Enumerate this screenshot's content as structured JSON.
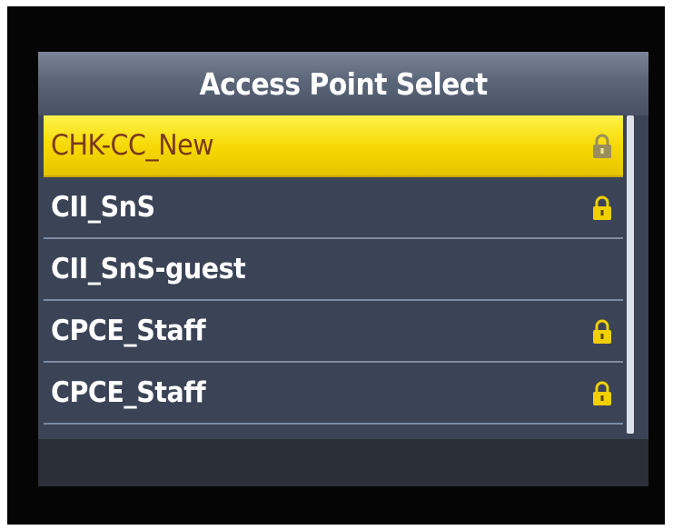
{
  "title": "Access Point Select",
  "access_points": [
    {
      "ssid": "CHK-CC_New",
      "secured": true,
      "selected": true,
      "icon": "lock-icon"
    },
    {
      "ssid": "CII_SnS",
      "secured": true,
      "selected": false,
      "icon": "lock-icon"
    },
    {
      "ssid": "CII_SnS-guest",
      "secured": false,
      "selected": false
    },
    {
      "ssid": "CPCE_Staff",
      "secured": true,
      "selected": false,
      "icon": "lock-icon"
    },
    {
      "ssid": "CPCE_Staff",
      "secured": true,
      "selected": false,
      "icon": "lock-icon"
    }
  ],
  "colors": {
    "highlight": "#f5d800",
    "highlight_text": "#7a3a1a",
    "background": "#3b4456",
    "lock": "#f2d000",
    "lock_selected": "#9a8f5a"
  }
}
